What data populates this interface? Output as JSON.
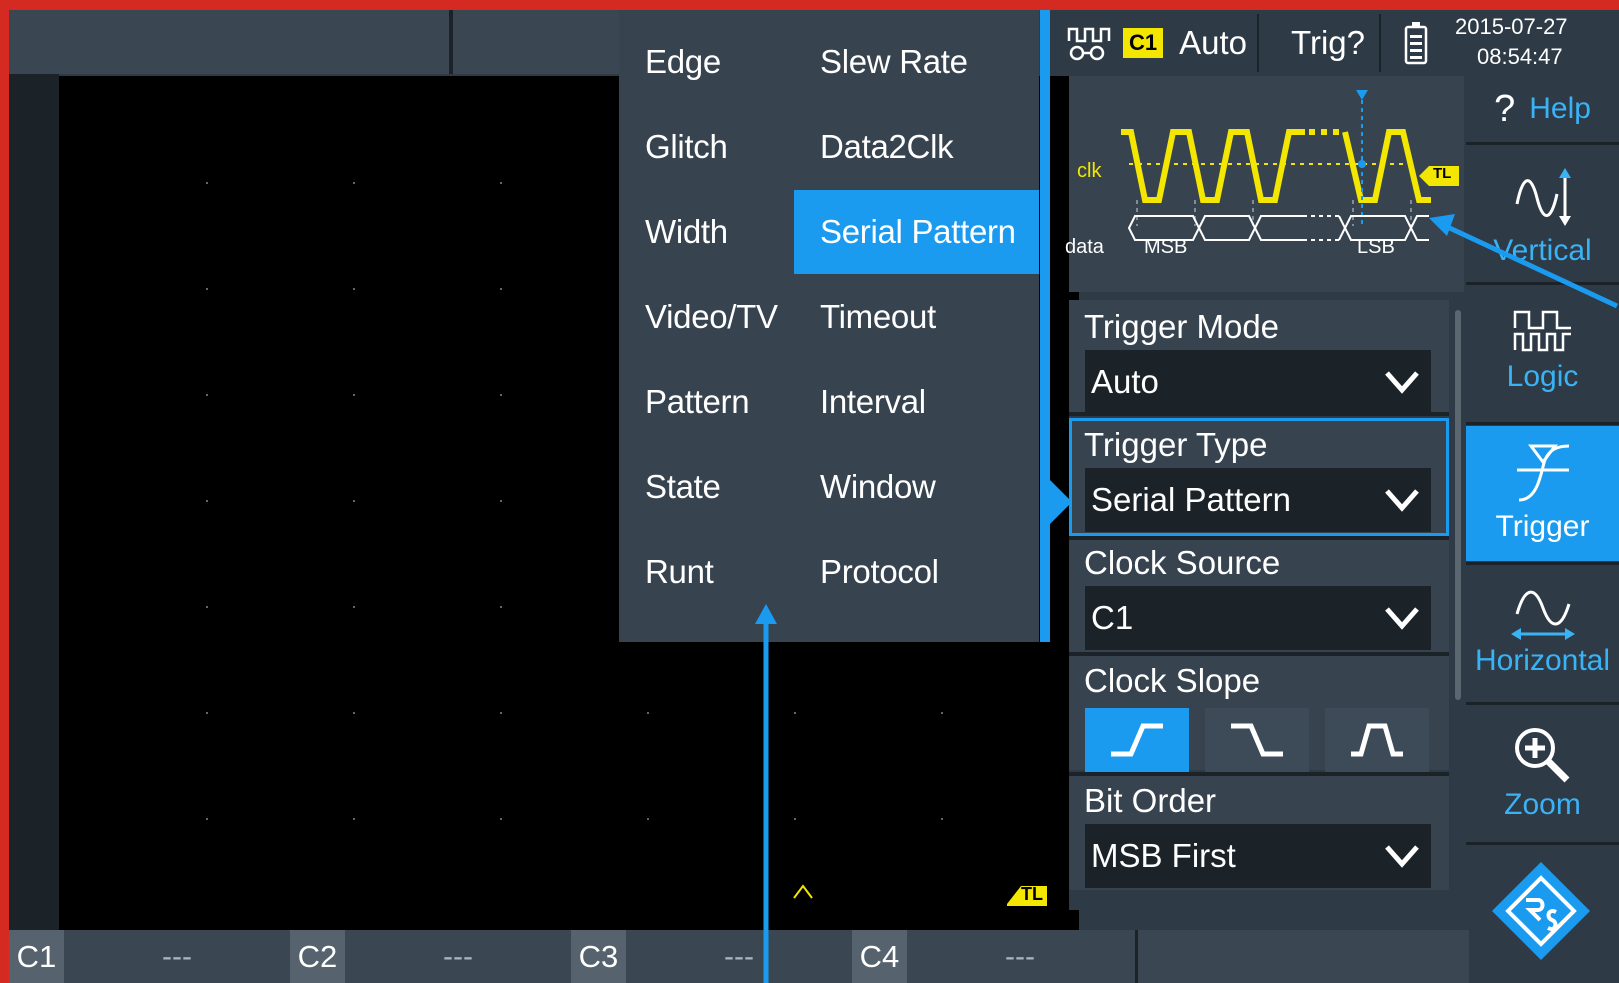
{
  "menu": {
    "col1": [
      "Edge",
      "Glitch",
      "Width",
      "Video/TV",
      "Pattern",
      "State",
      "Runt"
    ],
    "col2": [
      "Slew Rate",
      "Data2Clk",
      "Serial Pattern",
      "Timeout",
      "Interval",
      "Window",
      "Protocol"
    ],
    "selected": "Serial Pattern"
  },
  "status": {
    "channel_badge": "C1",
    "mode": "Auto",
    "trigger_state": "Trig?",
    "date": "2015-07-27",
    "time": "08:54:47"
  },
  "diagram": {
    "clk_label": "clk",
    "data_label": "data",
    "msb_label": "MSB",
    "lsb_label": "LSB",
    "tl_marker": "TL"
  },
  "panel": {
    "trigger_mode_label": "Trigger Mode",
    "trigger_mode_value": "Auto",
    "trigger_type_label": "Trigger Type",
    "trigger_type_value": "Serial Pattern",
    "clock_source_label": "Clock Source",
    "clock_source_value": "C1",
    "clock_slope_label": "Clock Slope",
    "clock_slope_selected": "rising",
    "bit_order_label": "Bit Order",
    "bit_order_value": "MSB First"
  },
  "toolbar": {
    "help_label": "Help",
    "items": [
      "Vertical",
      "Logic",
      "Trigger",
      "Horizontal",
      "Zoom"
    ],
    "active": "Trigger"
  },
  "channels": [
    {
      "name": "C1",
      "value": "---"
    },
    {
      "name": "C2",
      "value": "---"
    },
    {
      "name": "C3",
      "value": "---"
    },
    {
      "name": "C4",
      "value": "---"
    }
  ],
  "waveform": {
    "tl_marker": "TL"
  },
  "colors": {
    "accent": "#1a9bf0",
    "clock_trace": "#f3e600",
    "background_frame": "#d42a22"
  }
}
